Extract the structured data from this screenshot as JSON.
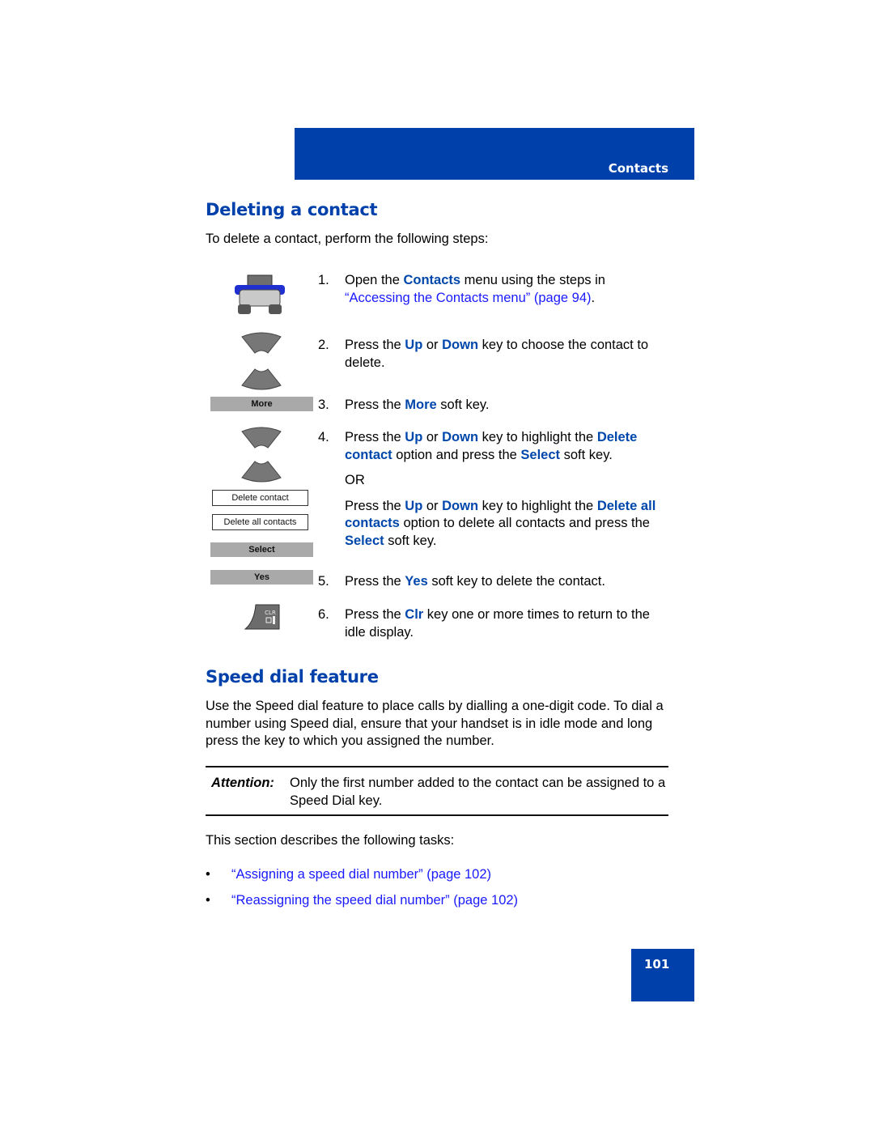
{
  "header": {
    "section_label": "Contacts"
  },
  "deleting": {
    "title": "Deleting a contact",
    "intro": "To delete a contact, perform the following steps:",
    "steps": [
      {
        "num": "1.",
        "t1": "Open the ",
        "b1": "Contacts",
        "t2": " menu using the steps in ",
        "link": "“Accessing the Contacts menu” (page 94)",
        "t3": "."
      },
      {
        "num": "2.",
        "t1": "Press the ",
        "b1": "Up",
        "t2": " or ",
        "b2": "Down",
        "t3": " key to choose the contact to delete."
      },
      {
        "num": "3.",
        "t1": "Press the ",
        "b1": "More",
        "t2": " soft key."
      },
      {
        "num": "4.",
        "t1": "Press the ",
        "b1": "Up",
        "t2": " or ",
        "b2": "Down",
        "t3": " key to highlight the ",
        "b3": "Delete contact",
        "t4": " option and press the ",
        "b4": "Select",
        "t5": " soft key.",
        "or": "OR",
        "alt": {
          "t1": "Press the ",
          "b1": "Up",
          "t2": " or ",
          "b2": "Down",
          "t3": " key to highlight the ",
          "b3": "Delete all contacts",
          "t4": " option to delete all contacts and press the ",
          "b4": "Select",
          "t5": " soft key."
        }
      },
      {
        "num": "5.",
        "t1": "Press the ",
        "b1": "Yes",
        "t2": " soft key to delete the contact."
      },
      {
        "num": "6.",
        "t1": "Press the ",
        "b1": "Clr",
        "t2": " key one or more times to return to the idle display."
      }
    ],
    "icons": {
      "softkey_more": "More",
      "menu_option_1": "Delete contact",
      "menu_option_2": "Delete all contacts",
      "softkey_select": "Select",
      "softkey_yes": "Yes",
      "clr_key_label": "CLR"
    }
  },
  "speed_dial": {
    "title": "Speed dial feature",
    "intro": "Use the Speed dial feature to place calls by dialling a one-digit code. To dial a number using Speed dial, ensure that your handset is in idle mode and long press the key to which you assigned the number.",
    "attention_label": "Attention:",
    "attention_text": "Only the first number added to the contact can be assigned to a Speed Dial key.",
    "tasks_intro": "This section describes the following tasks:",
    "tasks": [
      {
        "bullet": "•",
        "label": "“Assigning a speed dial number” (page 102)"
      },
      {
        "bullet": "•",
        "label": "“Reassigning the speed dial number” (page 102)"
      }
    ]
  },
  "footer": {
    "page_number": "101"
  },
  "colors": {
    "brand_blue": "#0040aa",
    "keyword_blue": "#0047ab",
    "link_blue": "#1a1aff",
    "softkey_gray": "#a9a9a9"
  }
}
